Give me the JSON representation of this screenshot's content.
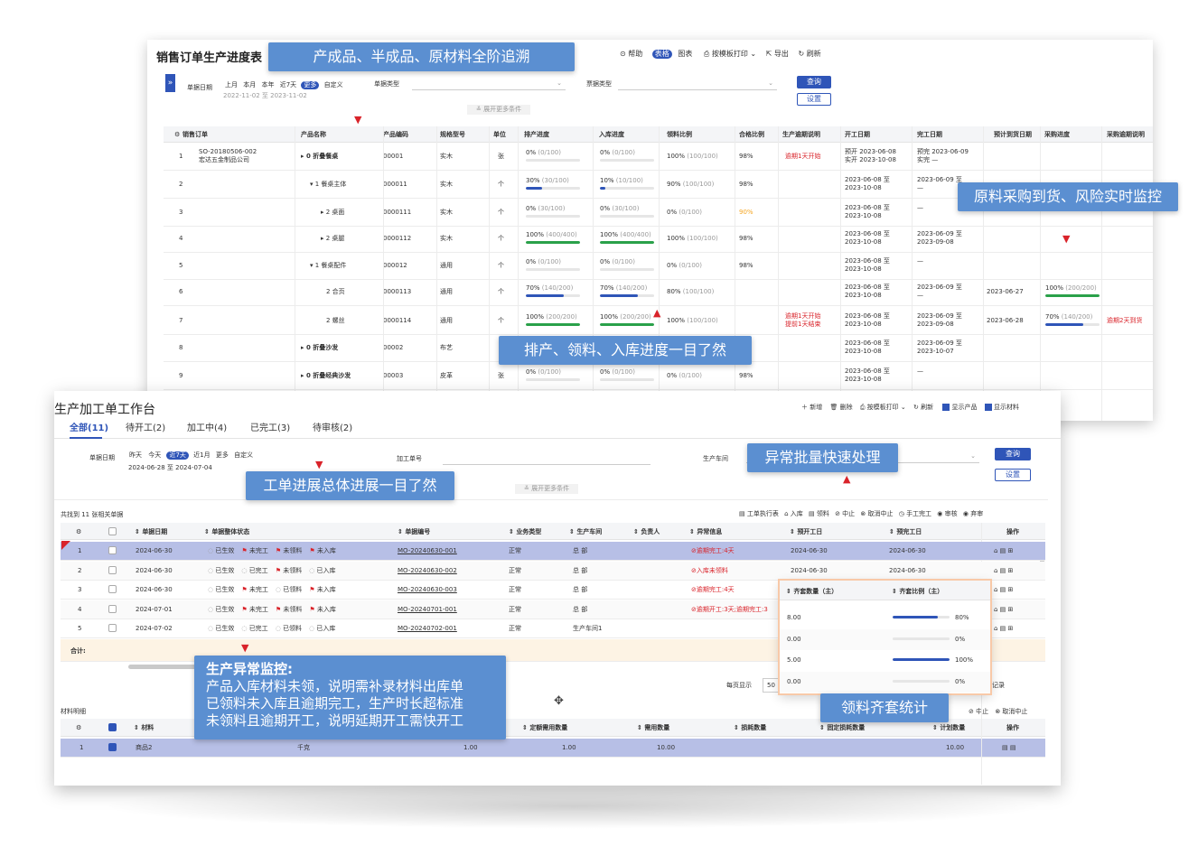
{
  "top": {
    "title": "销售订单生产进度表",
    "toolbar": [
      "帮助",
      "表格",
      "图表",
      "按模板打印",
      "导出",
      "刷新"
    ],
    "filter": {
      "date_label": "单据日期",
      "date_chips": [
        "上月",
        "本月",
        "本年",
        "近7天",
        "更多",
        "自定义"
      ],
      "active_chip": "更多",
      "date_range": "2022-11-02 至 2023-11-02",
      "type_label": "单据类型",
      "bill_type_label": "票据类型",
      "query": "查询",
      "settings": "设置",
      "expand": "展开更多条件"
    },
    "columns": [
      "销售订单",
      "产品名称",
      "产品编码",
      "规格型号",
      "单位",
      "排产进度",
      "入库进度",
      "领料比例",
      "合格比例",
      "生产逾期说明",
      "开工日期",
      "完工日期",
      "预计到货日期",
      "采购进度",
      "采购逾期说明"
    ],
    "rows": [
      {
        "no": "1",
        "order": "SO-20180506-002",
        "customer": "宏达五金制品公司",
        "product": "▸ 0 折叠餐桌",
        "code": "00001",
        "spec": "实木",
        "unit": "张",
        "sched": "0%",
        "sched_n": "(0/100)",
        "sched_p": 0,
        "stock": "0%",
        "stock_n": "(0/100)",
        "stock_p": 0,
        "pick": "100%",
        "pick_n": "(100/100)",
        "qual": "98%",
        "overdue": "逾期1天开始",
        "start": "预开 2023-06-08",
        "start2": "实开 2023-10-08",
        "end": "预完 2023-06-09",
        "end2": "实完 —",
        "arrive": "",
        "purch": "",
        "purch_n": "",
        "purch_p": -1,
        "purch_note": ""
      },
      {
        "no": "2",
        "order": "",
        "customer": "",
        "product": "▾ 1 餐桌主体",
        "code": "000011",
        "spec": "实木",
        "unit": "个",
        "sched": "30%",
        "sched_n": "(30/100)",
        "sched_p": 30,
        "stock": "10%",
        "stock_n": "(10/100)",
        "stock_p": 10,
        "pick": "90%",
        "pick_n": "(100/100)",
        "qual": "98%",
        "overdue": "",
        "start": "2023-06-08 至",
        "start2": "2023-10-08",
        "end": "2023-06-09 至",
        "end2": "—",
        "arrive": "",
        "purch": "",
        "purch_n": "",
        "purch_p": -1,
        "purch_note": ""
      },
      {
        "no": "3",
        "order": "",
        "customer": "",
        "product": "▸ 2 桌面",
        "code": "0000111",
        "spec": "实木",
        "unit": "个",
        "sched": "0%",
        "sched_n": "(30/100)",
        "sched_p": 0,
        "stock": "0%",
        "stock_n": "(30/100)",
        "stock_p": 0,
        "pick": "0%",
        "pick_n": "(0/100)",
        "qual": "90%",
        "overdue": "",
        "start": "2023-06-08 至",
        "start2": "2023-10-08",
        "end": "—",
        "end2": "",
        "arrive": "",
        "purch": "",
        "purch_n": "",
        "purch_p": -1,
        "purch_note": ""
      },
      {
        "no": "4",
        "order": "",
        "customer": "",
        "product": "▸ 2 桌腿",
        "code": "0000112",
        "spec": "实木",
        "unit": "个",
        "sched": "100%",
        "sched_n": "(400/400)",
        "sched_p": 100,
        "stock": "100%",
        "stock_n": "(400/400)",
        "stock_p": 100,
        "pick": "100%",
        "pick_n": "(100/100)",
        "qual": "98%",
        "overdue": "",
        "start": "2023-06-08 至",
        "start2": "2023-10-08",
        "end": "2023-06-09 至",
        "end2": "2023-09-08",
        "arrive": "",
        "purch": "",
        "purch_n": "",
        "purch_p": -1,
        "purch_note": ""
      },
      {
        "no": "5",
        "order": "",
        "customer": "",
        "product": "▾ 1 餐桌配件",
        "code": "000012",
        "spec": "通用",
        "unit": "个",
        "sched": "0%",
        "sched_n": "(0/100)",
        "sched_p": 0,
        "stock": "0%",
        "stock_n": "(0/100)",
        "stock_p": 0,
        "pick": "0%",
        "pick_n": "(0/100)",
        "qual": "98%",
        "overdue": "",
        "start": "2023-06-08 至",
        "start2": "2023-10-08",
        "end": "—",
        "end2": "",
        "arrive": "",
        "purch": "",
        "purch_n": "",
        "purch_p": -1,
        "purch_note": ""
      },
      {
        "no": "6",
        "order": "",
        "customer": "",
        "product": "2 合页",
        "code": "0000113",
        "spec": "通用",
        "unit": "个",
        "sched": "70%",
        "sched_n": "(140/200)",
        "sched_p": 70,
        "stock": "70%",
        "stock_n": "(140/200)",
        "stock_p": 70,
        "pick": "80%",
        "pick_n": "(100/100)",
        "qual": "",
        "overdue": "",
        "start": "2023-06-08 至",
        "start2": "2023-10-08",
        "end": "2023-06-09 至",
        "end2": "—",
        "arrive": "2023-06-27",
        "purch": "100%",
        "purch_n": "(200/200)",
        "purch_p": 100,
        "purch_note": ""
      },
      {
        "no": "7",
        "order": "",
        "customer": "",
        "product": "2 螺丝",
        "code": "0000114",
        "spec": "通用",
        "unit": "个",
        "sched": "100%",
        "sched_n": "(200/200)",
        "sched_p": 100,
        "stock": "100%",
        "stock_n": "(200/200)",
        "stock_p": 100,
        "pick": "100%",
        "pick_n": "(100/100)",
        "qual": "",
        "overdue": "逾期1天开始",
        "overdue2": "提前1天结束",
        "start": "2023-06-08 至",
        "start2": "2023-10-08",
        "end": "2023-06-09 至",
        "end2": "2023-09-08",
        "arrive": "2023-06-28",
        "purch": "70%",
        "purch_n": "(140/200)",
        "purch_p": 70,
        "purch_note": "逾期2天到货"
      },
      {
        "no": "8",
        "order": "",
        "customer": "",
        "product": "▸ 0 折叠沙发",
        "code": "00002",
        "spec": "布艺",
        "unit": "",
        "sched": "",
        "sched_n": "",
        "sched_p": -1,
        "stock": "",
        "stock_n": "",
        "stock_p": -1,
        "pick": "",
        "pick_n": "",
        "qual": "",
        "overdue": "",
        "start": "2023-06-08 至",
        "start2": "2023-10-08",
        "end": "2023-06-09 至",
        "end2": "2023-10-07",
        "arrive": "",
        "purch": "",
        "purch_n": "",
        "purch_p": -1,
        "purch_note": ""
      },
      {
        "no": "9",
        "order": "",
        "customer": "",
        "product": "▸ 0 折叠经典沙发",
        "code": "00003",
        "spec": "皮革",
        "unit": "张",
        "sched": "0%",
        "sched_n": "(0/100)",
        "sched_p": 0,
        "stock": "0%",
        "stock_n": "(0/100)",
        "stock_p": 0,
        "pick": "0%",
        "pick_n": "(0/100)",
        "qual": "98%",
        "overdue": "",
        "start": "2023-06-08 至",
        "start2": "2023-10-08",
        "end": "—",
        "end2": "",
        "arrive": "",
        "purch": "",
        "purch_n": "",
        "purch_p": -1,
        "purch_note": ""
      }
    ]
  },
  "bottom": {
    "title": "生产加工单工作台",
    "toolbar": [
      "新增",
      "删除",
      "按模板打印",
      "刷新",
      "显示产品",
      "显示材料"
    ],
    "tabs": [
      "全部(11)",
      "待开工(2)",
      "加工中(4)",
      "已完工(3)",
      "待审核(2)"
    ],
    "filter": {
      "date_label": "单据日期",
      "date_chips": [
        "昨天",
        "今天",
        "近7天",
        "近1月",
        "更多",
        "自定义"
      ],
      "active_chip": "近7天",
      "date_range": "2024-06-28 至 2024-07-04",
      "order_label": "加工单号",
      "workshop_label": "生产车间",
      "query": "查询",
      "settings": "设置",
      "expand": "展开更多条件"
    },
    "found": "共找到 11 张相关单据",
    "actions": [
      "工单执行表",
      "入库",
      "领料",
      "中止",
      "取消中止",
      "手工完工",
      "审核",
      "弃审"
    ],
    "columns": [
      "单据日期",
      "单据整体状态",
      "单据编号",
      "业务类型",
      "生产车间",
      "负责人",
      "异常信息",
      "预开工日",
      "预完工日",
      "操作"
    ],
    "rows": [
      {
        "no": "1",
        "date": "2024-06-30",
        "s1": "已生效",
        "s2": "未完工",
        "s3": "未领料",
        "s4": "未入库",
        "f2": true,
        "f3": true,
        "f4": true,
        "code": "MO-20240630-001",
        "type": "正常",
        "ws": "总 部",
        "err": "逾期完工:4天",
        "start": "2024-06-30",
        "end": "2024-06-30"
      },
      {
        "no": "2",
        "date": "2024-06-30",
        "s1": "已生效",
        "s2": "已完工",
        "s3": "未领料",
        "s4": "已入库",
        "f2": false,
        "f3": true,
        "f4": false,
        "code": "MO-20240630-002",
        "type": "正常",
        "ws": "总 部",
        "err": "入库未领料",
        "start": "2024-06-30",
        "end": "2024-06-30"
      },
      {
        "no": "3",
        "date": "2024-06-30",
        "s1": "已生效",
        "s2": "未完工",
        "s3": "已领料",
        "s4": "未入库",
        "f2": true,
        "f3": false,
        "f4": true,
        "code": "MO-20240630-003",
        "type": "正常",
        "ws": "总 部",
        "err": "逾期完工:4天",
        "start": "",
        "end": ""
      },
      {
        "no": "4",
        "date": "2024-07-01",
        "s1": "已生效",
        "s2": "未完工",
        "s3": "未领料",
        "s4": "未入库",
        "f2": true,
        "f3": true,
        "f4": true,
        "code": "MO-20240701-001",
        "type": "正常",
        "ws": "总 部",
        "err": "逾期开工:3天;逾期完工:3",
        "start": "",
        "end": ""
      },
      {
        "no": "5",
        "date": "2024-07-02",
        "s1": "已生效",
        "s2": "已完工",
        "s3": "已领料",
        "s4": "已入库",
        "f2": false,
        "f3": false,
        "f4": false,
        "code": "MO-20240702-001",
        "type": "正常",
        "ws": "生产车间1",
        "err": "",
        "start": "",
        "end": ""
      }
    ],
    "total_label": "合计:",
    "page_size_label": "每页显示",
    "page_size": "50",
    "records_suffix": "记录",
    "materials": {
      "title": "材料明细",
      "actions": [
        "中止",
        "取消中止"
      ],
      "columns": [
        "材料",
        "定额需用数量",
        "需用数量",
        "损耗数量",
        "固定损耗数量",
        "计划数量",
        "操作"
      ],
      "row": {
        "no": "1",
        "name": "商品2",
        "unit": "千克",
        "v1": "1.00",
        "v2": "1.00",
        "v3": "10.00",
        "v4": "10.00"
      }
    },
    "popup": {
      "col1": "齐套数量（主）",
      "col2": "齐套比例（主）",
      "rows": [
        {
          "qty": "8.00",
          "ratio": "80%",
          "p": 80
        },
        {
          "qty": "0.00",
          "ratio": "0%",
          "p": 0
        },
        {
          "qty": "5.00",
          "ratio": "100%",
          "p": 100
        },
        {
          "qty": "0.00",
          "ratio": "0%",
          "p": 0
        }
      ]
    }
  },
  "callouts": {
    "c1": "产成品、半成品、原材料全阶追溯",
    "c2": "原料采购到货、风险实时监控",
    "c3": "排产、领料、入库进度一目了然",
    "c4": "异常批量快速处理",
    "c5": "工单进展总体进展一目了然",
    "c6_title": "生产异常监控:",
    "c6_lines": [
      "产品入库材料未领，说明需补录材料出库单",
      "已领料未入库且逾期完工，生产时长超标准",
      "未领料且逾期开工，说明延期开工需快开工"
    ],
    "c7": "领料齐套统计"
  },
  "colors": {
    "accent": "#2f55b8",
    "callout": "#5b8fd1",
    "danger": "#d9232a",
    "ok": "#2aa14a",
    "warn": "#f5a623"
  }
}
